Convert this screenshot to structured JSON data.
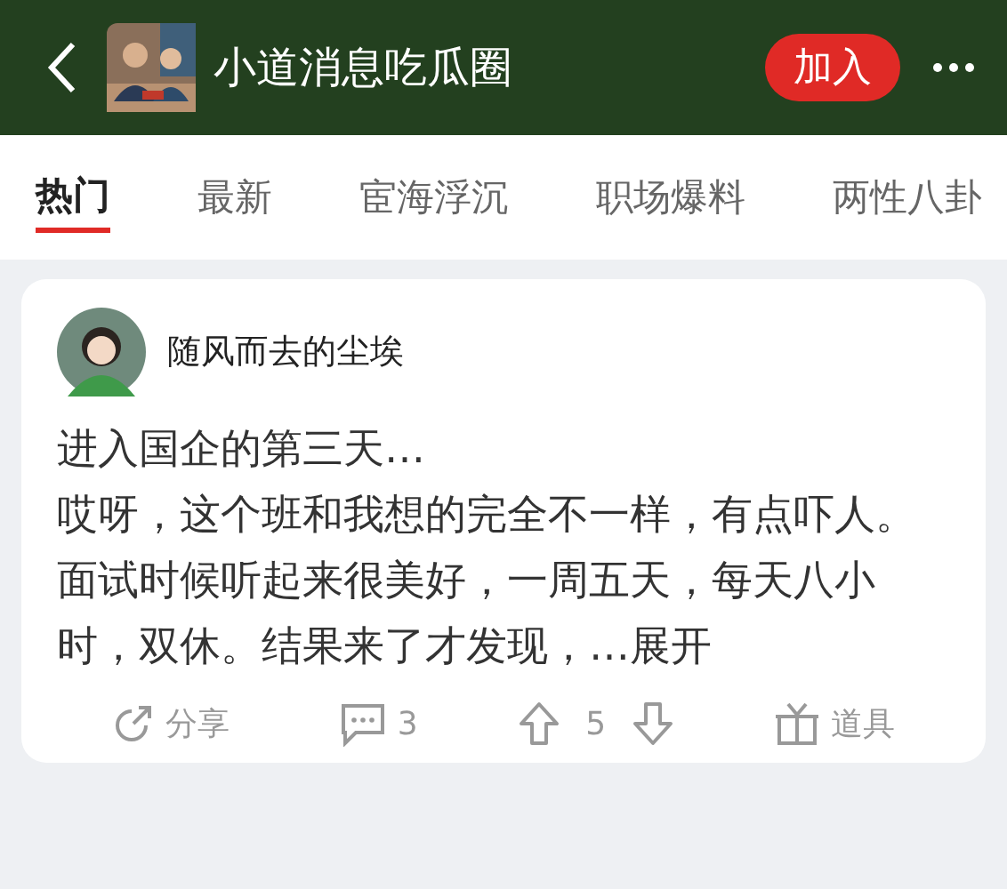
{
  "header": {
    "title": "小道消息吃瓜圈",
    "join_button": "加入"
  },
  "tabs": [
    {
      "label": "热门",
      "selected": true
    },
    {
      "label": "最新",
      "selected": false
    },
    {
      "label": "宦海浮沉",
      "selected": false
    },
    {
      "label": "职场爆料",
      "selected": false
    },
    {
      "label": "两性八卦",
      "selected": false
    }
  ],
  "post": {
    "author": "随风而去的尘埃",
    "lines": [
      "进入国企的第三天…",
      "哎呀，这个班和我想的完全不一样，有点吓人。",
      "面试时候听起来很美好，一周五天，每天八小时，双休。结果来了才发现，…"
    ],
    "expand_link": "展开",
    "actions": [
      {
        "kind": "share",
        "label": "分享"
      },
      {
        "kind": "comment",
        "label": "3"
      },
      {
        "kind": "vote",
        "label": "5"
      },
      {
        "kind": "gift",
        "label": "道具"
      }
    ]
  }
}
